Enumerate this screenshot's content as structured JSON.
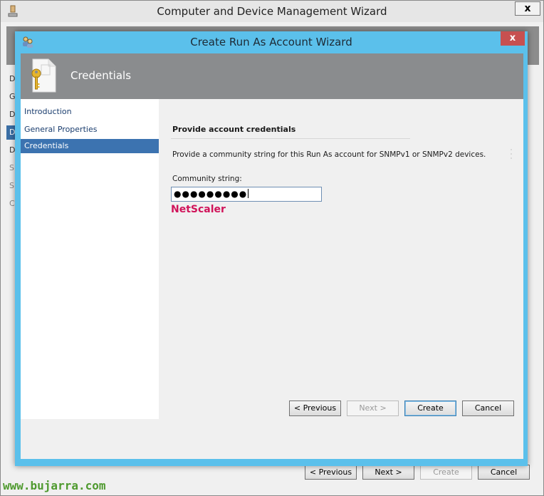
{
  "outer_window": {
    "title": "Computer and Device Management Wizard",
    "close_glyph": "x",
    "nav_letters": [
      "D",
      "G",
      "D",
      "D",
      "D",
      "S",
      "S",
      "C"
    ],
    "buttons": {
      "previous": "< Previous",
      "next": "Next >",
      "create": "Create",
      "cancel": "Cancel"
    }
  },
  "dialog": {
    "title": "Create Run As Account Wizard",
    "close_glyph": "x",
    "header_title": "Credentials",
    "nav": [
      {
        "label": "Introduction",
        "selected": false
      },
      {
        "label": "General Properties",
        "selected": false
      },
      {
        "label": "Credentials",
        "selected": true
      }
    ],
    "section_title": "Provide account credentials",
    "description": "Provide a community string for this Run As account for SNMPv1 or SNMPv2 devices.",
    "community_label": "Community string:",
    "community_value": "●●●●●●●●●",
    "annotation": "NetScaler",
    "buttons": {
      "previous": "< Previous",
      "next": "Next >",
      "create": "Create",
      "cancel": "Cancel"
    }
  },
  "watermark": "www.bujarra.com",
  "colors": {
    "dialog_frame": "#5bc0eb",
    "header": "#8a8c8e",
    "selection": "#3c73b0",
    "close": "#c75050",
    "annotation": "#d0145a",
    "watermark": "#4f9a2f"
  },
  "icons": {
    "outer_app": "computer-icon",
    "dialog_app": "run-as-account-icon",
    "header": "key-document-icon"
  }
}
